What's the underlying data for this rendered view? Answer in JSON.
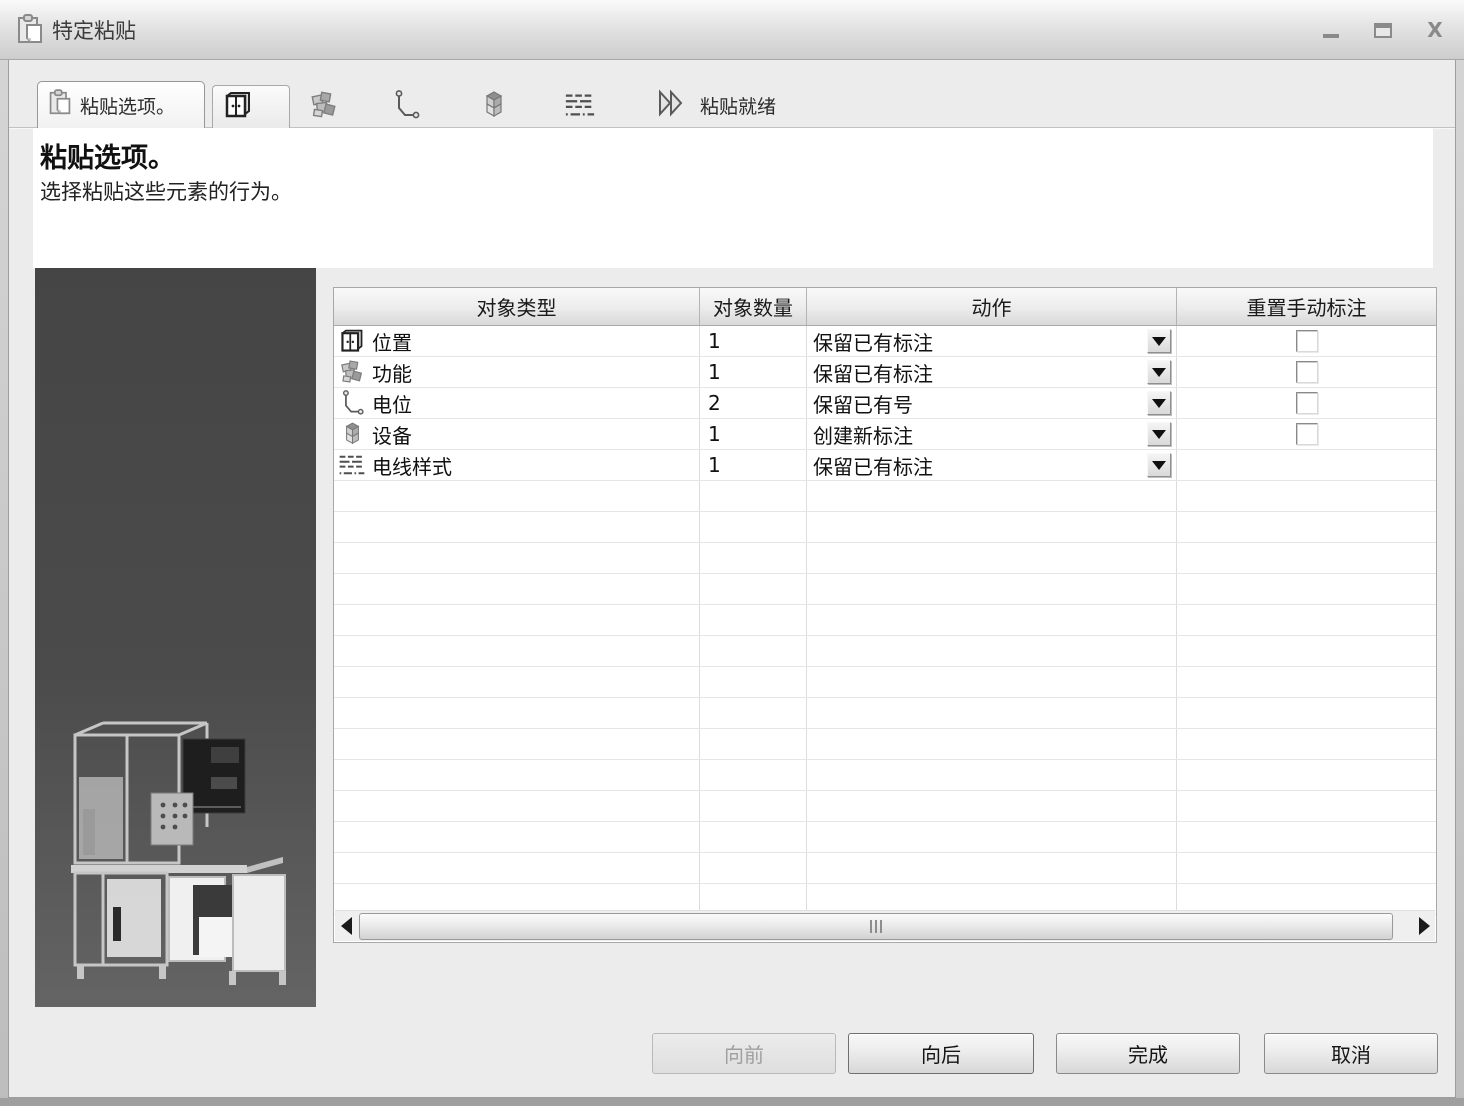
{
  "window": {
    "title": "特定粘贴",
    "controls": [
      {
        "name": "minimize-icon"
      },
      {
        "name": "maximize-icon"
      },
      {
        "name": "close-icon"
      }
    ]
  },
  "tabs": [
    {
      "label": "粘贴选项。",
      "icon": "paste-icon",
      "active": true
    },
    {
      "label": "",
      "icon": "location-icon",
      "active": false
    },
    {
      "label": "",
      "icon": "function-icon",
      "active": false
    },
    {
      "label": "",
      "icon": "potential-icon",
      "active": false
    },
    {
      "label": "",
      "icon": "device-icon",
      "active": false
    },
    {
      "label": "",
      "icon": "wire-style-icon",
      "active": false
    },
    {
      "label": "粘贴就绪",
      "icon": "ready-icon",
      "active": false
    }
  ],
  "header": {
    "title": "粘贴选项。",
    "subtitle": "选择粘贴这些元素的行为。"
  },
  "table": {
    "columns": [
      "对象类型",
      "对象数量",
      "动作",
      "重置手动标注"
    ],
    "rows": [
      {
        "icon": "location-icon",
        "type": "位置",
        "count": "1",
        "action": "保留已有标注",
        "has_checkbox": true,
        "checked": false
      },
      {
        "icon": "function-icon",
        "type": "功能",
        "count": "1",
        "action": "保留已有标注",
        "has_checkbox": true,
        "checked": false
      },
      {
        "icon": "potential-icon",
        "type": "电位",
        "count": "2",
        "action": "保留已有号",
        "has_checkbox": true,
        "checked": false
      },
      {
        "icon": "device-icon",
        "type": "设备",
        "count": "1",
        "action": "创建新标注",
        "has_checkbox": true,
        "checked": false
      },
      {
        "icon": "wire-style-icon",
        "type": "电线样式",
        "count": "1",
        "action": "保留已有标注",
        "has_checkbox": false,
        "checked": false
      }
    ],
    "empty_row_count": 14
  },
  "buttons": [
    {
      "label": "向前",
      "enabled": false
    },
    {
      "label": "向后",
      "enabled": true
    },
    {
      "label": "完成",
      "enabled": true
    },
    {
      "label": "取消",
      "enabled": true
    }
  ],
  "colors": {
    "dialog_background": "#ececec",
    "panel_background": "#ffffff",
    "image_panel_top": "#454545",
    "image_panel_bottom": "#646464",
    "text": "#111111"
  }
}
